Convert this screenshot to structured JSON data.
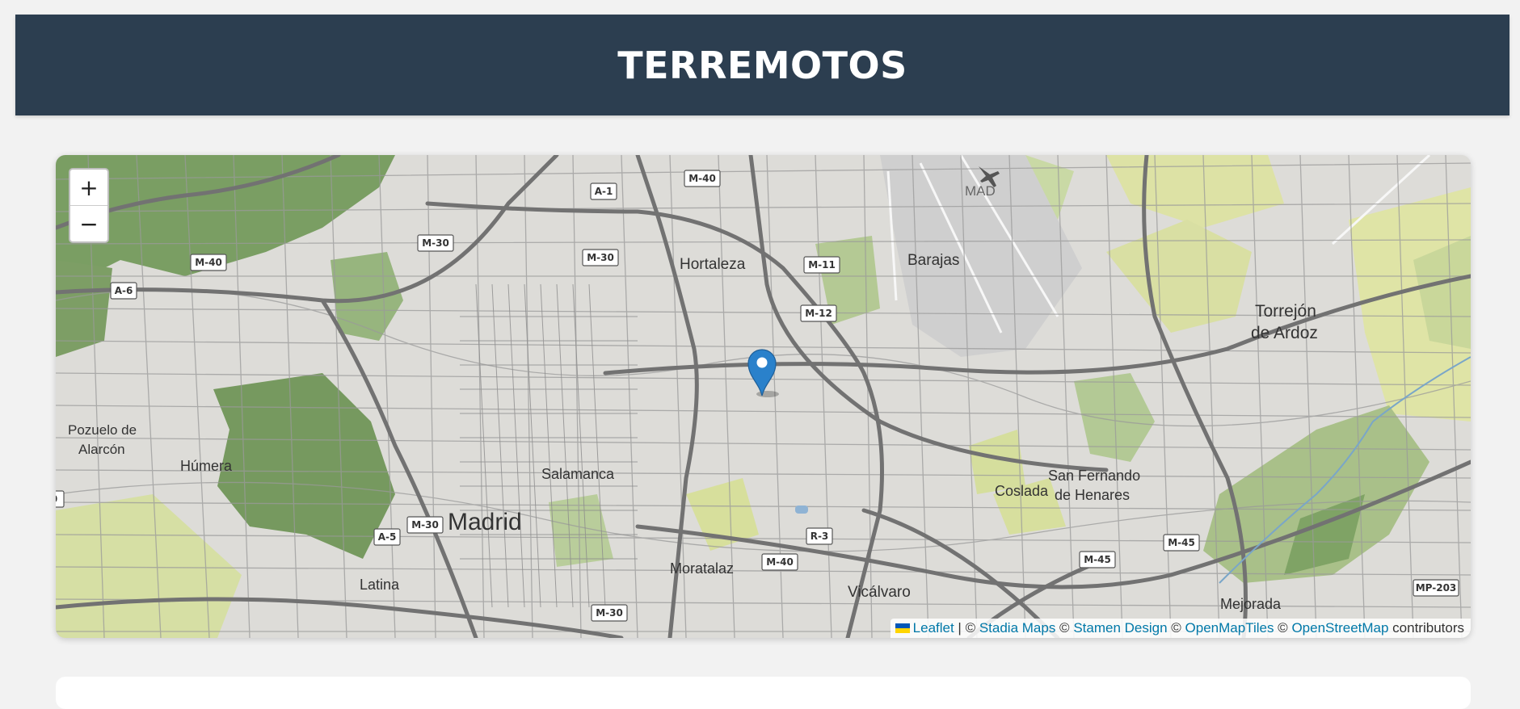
{
  "header": {
    "title": "TERREMOTOS"
  },
  "map": {
    "zoom_in_label": "+",
    "zoom_out_label": "−",
    "places": {
      "madrid": "Madrid",
      "hortaleza": "Hortaleza",
      "barajas": "Barajas",
      "mad": "MAD",
      "torrejon_1": "Torrejón",
      "torrejon_2": "de Ardoz",
      "pozuelo_1": "Pozuelo de",
      "pozuelo_2": "Alarcón",
      "humera": "Húmera",
      "salamanca": "Salamanca",
      "coslada": "Coslada",
      "san_fernando_1": "San Fernando",
      "san_fernando_2": "de Henares",
      "moratalaz": "Moratalaz",
      "vicalvaro": "Vicálvaro",
      "latina": "Latina",
      "mejorada": "Mejorada"
    },
    "roads": {
      "a1": "A-1",
      "m40_top": "M-40",
      "m30_a": "M-30",
      "m30_b": "M-30",
      "m40_left": "M-40",
      "a6": "A-6",
      "m11": "M-11",
      "m12": "M-12",
      "a5": "A-5",
      "m30_c": "M-30",
      "r3": "R-3",
      "m40_bottom": "M-40",
      "m45_a": "M-45",
      "m45_b": "M-45",
      "m30_d": "M-30",
      "mp203": "MP-203",
      "edge": "0"
    },
    "attribution": {
      "leaflet": "Leaflet",
      "sep1": " | © ",
      "stadia": "Stadia Maps",
      "sep2": " © ",
      "stamen": "Stamen Design",
      "sep3": " © ",
      "openmaptiles": "OpenMapTiles",
      "sep4": " © ",
      "osm": "OpenStreetMap",
      "suffix": " contributors"
    },
    "colors": {
      "marker": "#2a81cb",
      "header": "#2c3e50",
      "link": "#0078a8"
    }
  }
}
